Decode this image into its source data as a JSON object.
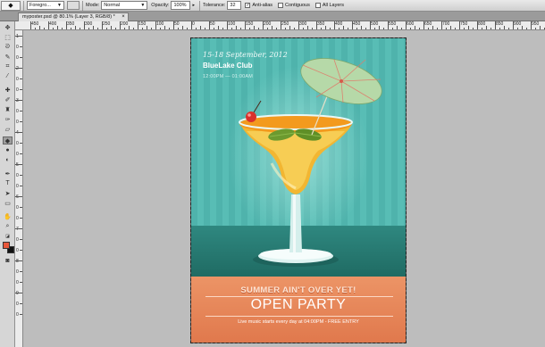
{
  "options_bar": {
    "fill_source": "Foregro...",
    "mode_label": "Mode:",
    "mode_value": "Normal",
    "opacity_label": "Opacity:",
    "opacity_value": "100%",
    "tolerance_label": "Tolerance:",
    "tolerance_value": "32",
    "anti_alias_label": "Anti-alias",
    "contiguous_label": "Contiguous",
    "all_layers_label": "All Layers"
  },
  "document_tab": {
    "title": "myposter.psd @ 80.1% (Layer 3, RGB/8) *"
  },
  "ruler": {
    "top_labels": [
      "450",
      "400",
      "350",
      "300",
      "250",
      "200",
      "150",
      "100",
      "50",
      "0",
      "50",
      "100",
      "150",
      "200",
      "250",
      "300",
      "350",
      "400",
      "450",
      "500",
      "550",
      "600",
      "650",
      "700",
      "750",
      "800",
      "850",
      "900",
      "950"
    ],
    "left_labels": [
      "1",
      "0",
      "0",
      "2",
      "0",
      "0",
      "3",
      "0",
      "0",
      "4",
      "0",
      "0",
      "5",
      "0",
      "0",
      "6",
      "0",
      "0",
      "7",
      "0",
      "0",
      "8",
      "0",
      "0",
      "9",
      "0",
      "0"
    ]
  },
  "poster": {
    "date": "15-18 September, 2012",
    "club": "BlueLake Club",
    "time": "12:00PM — 01:00AM",
    "summer": "SUMMER AIN'T OVER YET!",
    "headline": "OPEN PARTY",
    "info": "Live music starts every day at 04:00PM  -  FREE  ENTRY"
  },
  "colors": {
    "foreground": "#e8573a",
    "background": "#111111",
    "poster_teal": "#4fb3ac",
    "poster_orange": "#e8875a"
  },
  "tools": [
    "move-icon",
    "marquee-icon",
    "lasso-icon",
    "quick-select-icon",
    "crop-icon",
    "eyedropper-icon",
    "healing-icon",
    "brush-icon",
    "stamp-icon",
    "history-brush-icon",
    "eraser-icon",
    "paint-bucket-icon",
    "blur-icon",
    "dodge-icon",
    "pen-icon",
    "type-icon",
    "path-select-icon",
    "shape-icon",
    "hand-icon",
    "zoom-icon"
  ]
}
